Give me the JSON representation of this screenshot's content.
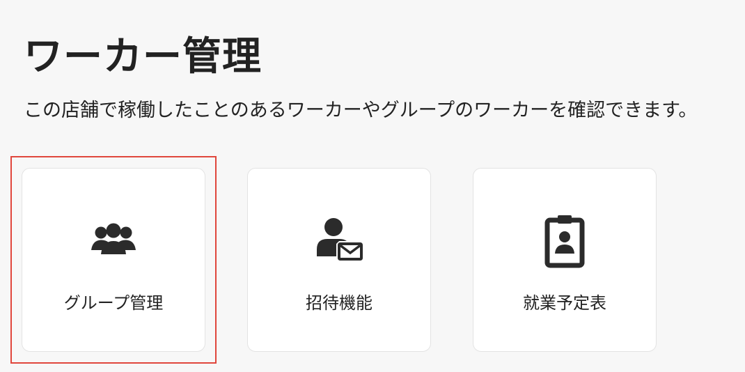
{
  "page": {
    "title": "ワーカー管理",
    "description": "この店舗で稼働したことのあるワーカーやグループのワーカーを確認できます。"
  },
  "cards": [
    {
      "label": "グループ管理",
      "icon": "users-group-icon"
    },
    {
      "label": "招待機能",
      "icon": "user-envelope-icon"
    },
    {
      "label": "就業予定表",
      "icon": "id-badge-clipboard-icon"
    }
  ],
  "colors": {
    "background": "#f7f7f7",
    "card_background": "#ffffff",
    "card_border": "#e3e3e3",
    "text": "#222222",
    "icon": "#2b2b2b",
    "highlight": "#e0463c"
  }
}
